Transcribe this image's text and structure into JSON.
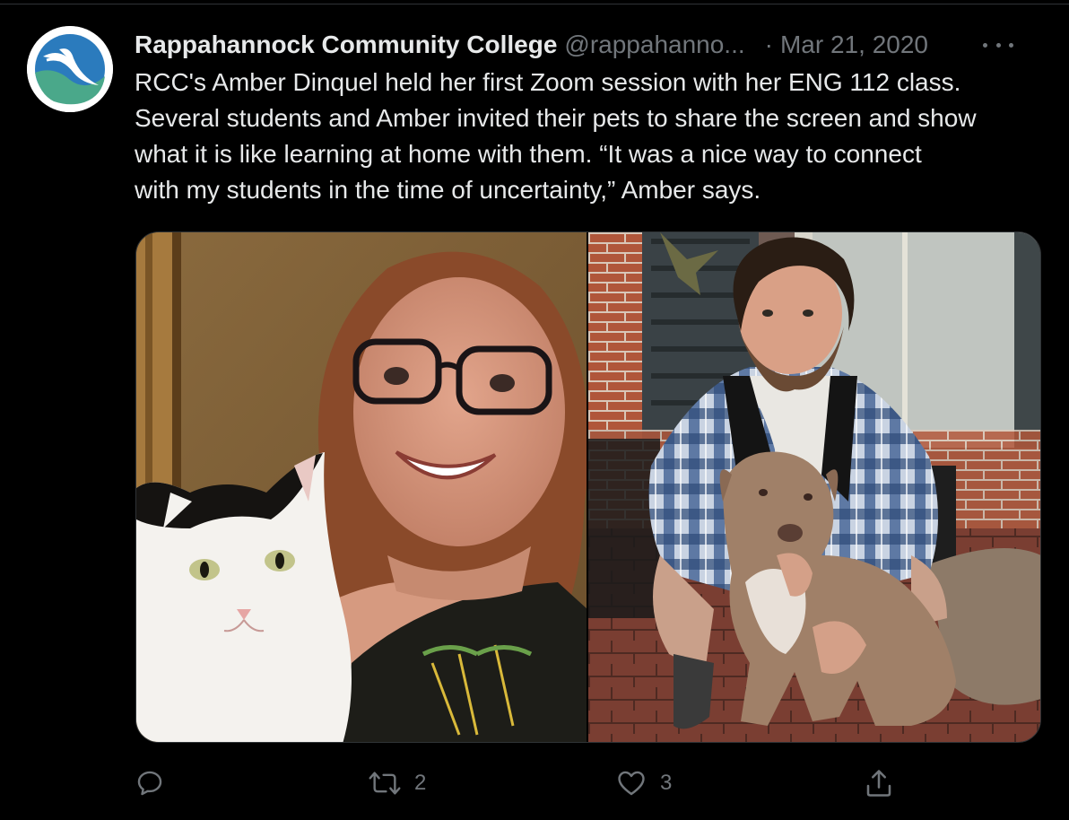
{
  "tweet": {
    "author": {
      "display_name": "Rappahannock Community College",
      "handle": "@rappahanno...",
      "avatar_icon": "rcc-heron-logo"
    },
    "separator": "·",
    "date": "Mar 21, 2020",
    "more_icon": "more-dots-icon",
    "text_lines": [
      "RCC's Amber Dinquel held her first Zoom session with her ENG 112 class.",
      "Several students and Amber invited their pets to share the screen and show",
      "what it is like learning at home with them. “It was a nice way to connect",
      "with my students in the time of uncertainty,” Amber says."
    ],
    "media": [
      {
        "name": "photo-woman-with-cat",
        "icon": "photo"
      },
      {
        "name": "photo-man-with-dog",
        "icon": "photo"
      }
    ],
    "actions": {
      "reply": {
        "icon": "reply-icon",
        "count": ""
      },
      "retweet": {
        "icon": "retweet-icon",
        "count": "2"
      },
      "like": {
        "icon": "heart-icon",
        "count": "3"
      },
      "share": {
        "icon": "share-icon",
        "count": ""
      }
    }
  },
  "colors": {
    "background": "#000000",
    "text_primary": "#e7e9ea",
    "text_secondary": "#71767b",
    "border": "#2f3336",
    "logo_blue": "#2b7bbd",
    "logo_green": "#4aa88a"
  }
}
